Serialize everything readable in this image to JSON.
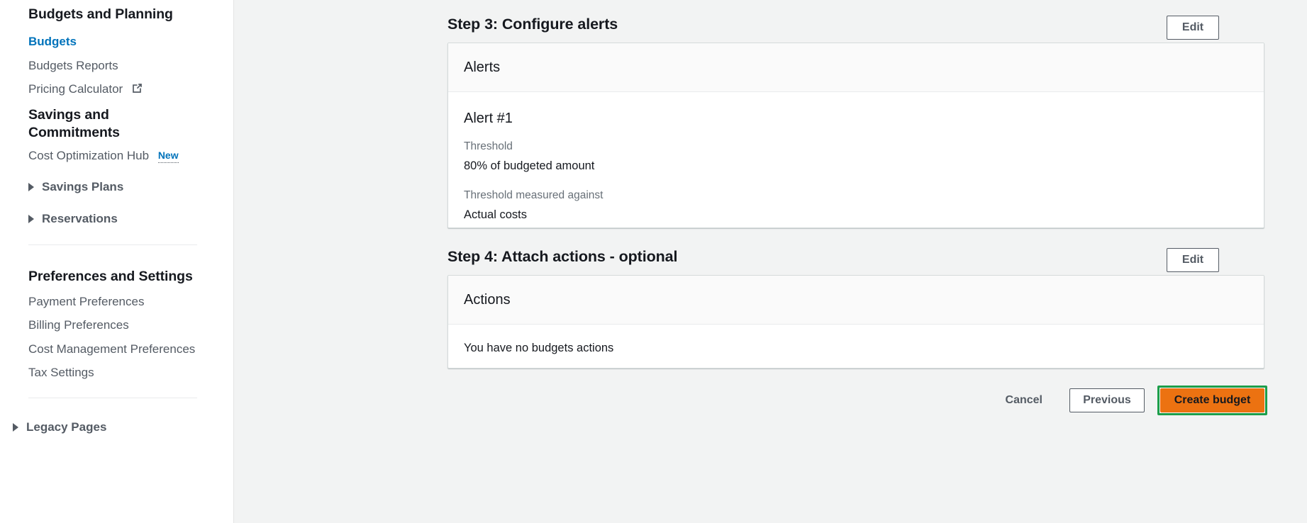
{
  "sidebar": {
    "sections": [
      {
        "heading": "Budgets and Planning",
        "items": [
          {
            "label": "Budgets",
            "selected": true
          },
          {
            "label": "Budgets Reports",
            "selected": false
          },
          {
            "label": "Pricing Calculator",
            "selected": false,
            "icon": "external-link-icon"
          }
        ]
      },
      {
        "heading": "Savings and Commitments",
        "items": [
          {
            "label": "Cost Optimization Hub",
            "selected": false,
            "badge": "New"
          }
        ],
        "expandables": [
          {
            "label": "Savings Plans",
            "icon": "chevron-right-icon"
          },
          {
            "label": "Reservations",
            "icon": "chevron-right-icon"
          }
        ]
      },
      {
        "heading": "Preferences and Settings",
        "items": [
          {
            "label": "Payment Preferences",
            "selected": false
          },
          {
            "label": "Billing Preferences",
            "selected": false
          },
          {
            "label": "Cost Management Preferences",
            "selected": false
          },
          {
            "label": "Tax Settings",
            "selected": false
          }
        ]
      }
    ],
    "legacy": {
      "label": "Legacy Pages",
      "icon": "chevron-right-icon"
    },
    "scrollbar": {
      "up_icon": "scroll-up-arrow-icon",
      "down_icon": "scroll-down-arrow-icon"
    }
  },
  "main": {
    "step3": {
      "title": "Step 3: Configure alerts",
      "edit_label": "Edit",
      "card_title": "Alerts",
      "alert": {
        "name": "Alert #1",
        "threshold_label": "Threshold",
        "threshold_value": "80% of budgeted amount",
        "measured_label": "Threshold measured against",
        "measured_value": "Actual costs"
      }
    },
    "step4": {
      "title": "Step 4: Attach actions - optional",
      "edit_label": "Edit",
      "card_title": "Actions",
      "empty_message": "You have no budgets actions"
    },
    "footer": {
      "cancel_label": "Cancel",
      "previous_label": "Previous",
      "create_label": "Create budget"
    }
  },
  "colors": {
    "page_background": "#f2f3f3",
    "card_background": "#ffffff",
    "card_header_background": "#fafafa",
    "link_blue": "#0073bb",
    "text_primary": "#16191f",
    "text_secondary": "#545b64",
    "label_gray": "#687078",
    "primary_button": "#ec7211",
    "focus_outline_green": "#1d9e4a",
    "border": "#d5dbdb"
  }
}
